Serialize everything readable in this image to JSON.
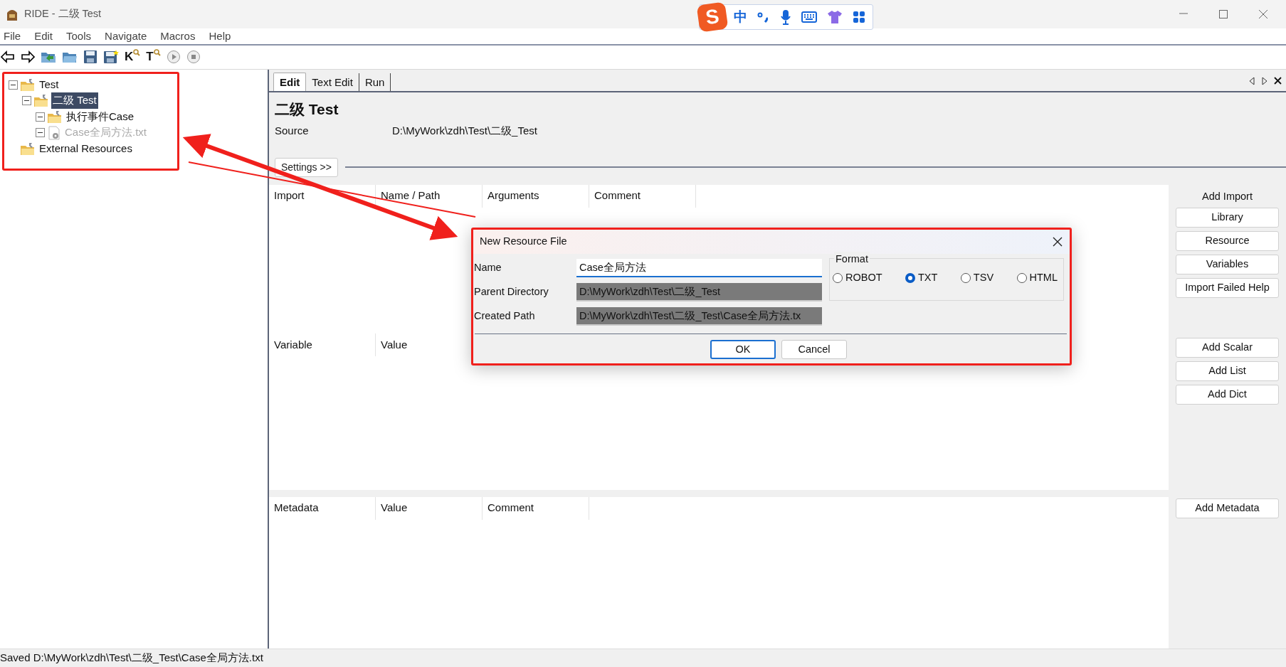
{
  "window": {
    "title": "RIDE - 二级 Test"
  },
  "ime_bar": {
    "logo": "S",
    "mode": "中"
  },
  "menu": [
    "File",
    "Edit",
    "Tools",
    "Navigate",
    "Macros",
    "Help"
  ],
  "toolbar": [
    {
      "kind": "back"
    },
    {
      "kind": "forward"
    },
    {
      "kind": "open"
    },
    {
      "kind": "folder"
    },
    {
      "kind": "save"
    },
    {
      "kind": "save-all"
    },
    {
      "kind": "search",
      "glyph": "K"
    },
    {
      "kind": "search",
      "glyph": "T"
    },
    {
      "kind": "run"
    },
    {
      "kind": "stop"
    }
  ],
  "tree": [
    {
      "label": "Test",
      "kind": "folder",
      "expanded": true,
      "selected": false,
      "disabled": false,
      "children": [
        {
          "label": "二级 Test",
          "kind": "folder",
          "expanded": true,
          "selected": true,
          "disabled": false,
          "children": [
            {
              "label": "执行事件Case",
              "kind": "folder",
              "expanded": true,
              "selected": false,
              "disabled": false
            },
            {
              "label": "Case全局方法.txt",
              "kind": "file",
              "expanded": true,
              "selected": false,
              "disabled": true
            }
          ]
        }
      ]
    },
    {
      "label": "External Resources",
      "kind": "folder",
      "expanded": false,
      "selected": false,
      "disabled": false
    }
  ],
  "tabs": [
    {
      "label": "Edit",
      "selected": true
    },
    {
      "label": "Text Edit",
      "selected": false
    },
    {
      "label": "Run",
      "selected": false
    }
  ],
  "editor": {
    "title": "二级 Test",
    "source_label": "Source",
    "source_value": "D:\\MyWork\\zdh\\Test\\二级_Test",
    "settings_button": "Settings >>",
    "sections": [
      {
        "columns": [
          "Import",
          "Name / Path",
          "Arguments",
          "Comment"
        ],
        "heading": "Add Import",
        "buttons": [
          "Library",
          "Resource",
          "Variables",
          "Import Failed Help"
        ]
      },
      {
        "columns": [
          "Variable",
          "Value"
        ],
        "buttons": [
          "Add Scalar",
          "Add List",
          "Add Dict"
        ]
      },
      {
        "columns": [
          "Metadata",
          "Value",
          "Comment"
        ],
        "buttons": [
          "Add Metadata"
        ]
      }
    ]
  },
  "dialog": {
    "title": "New Resource File",
    "fields": [
      {
        "label": "Name",
        "value": "Case全局方法",
        "disabled": false
      },
      {
        "label": "Parent Directory",
        "value": "D:\\MyWork\\zdh\\Test\\二级_Test",
        "disabled": true
      },
      {
        "label": "Created Path",
        "value": "D:\\MyWork\\zdh\\Test\\二级_Test\\Case全局方法.tx",
        "disabled": true
      }
    ],
    "format": {
      "label": "Format",
      "options": [
        {
          "label": "ROBOT",
          "selected": false
        },
        {
          "label": "TXT",
          "selected": true
        },
        {
          "label": "TSV",
          "selected": false
        },
        {
          "label": "HTML",
          "selected": false
        }
      ]
    },
    "buttons": [
      {
        "label": "OK",
        "kind": "default"
      },
      {
        "label": "Cancel",
        "kind": "normal"
      }
    ]
  },
  "status_bar": "Saved D:\\MyWork\\zdh\\Test\\二级_Test\\Case全局方法.txt"
}
